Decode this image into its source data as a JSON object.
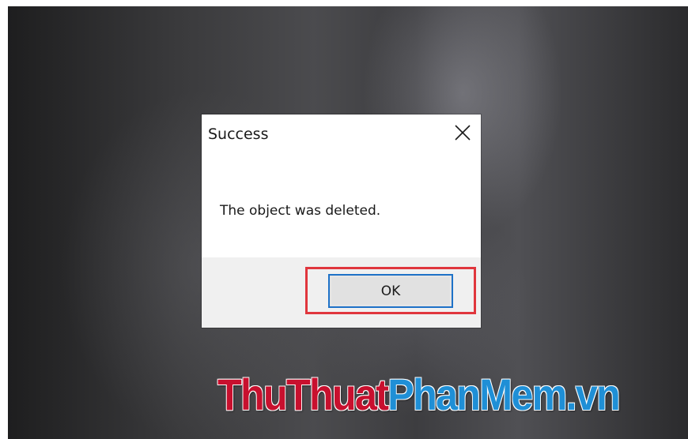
{
  "dialog": {
    "title": "Success",
    "message": "The object was deleted.",
    "ok_label": "OK"
  },
  "watermark": {
    "part1": "ThuThuat",
    "part2": "PhanMem.vn"
  },
  "colors": {
    "highlight_border": "#e0363d",
    "button_focus_border": "#1e72c8",
    "footer_bg": "#f0f0f0",
    "watermark_red": "#c8102e",
    "watermark_blue": "#1f8fd6"
  },
  "icons": {
    "close": "close-icon"
  }
}
